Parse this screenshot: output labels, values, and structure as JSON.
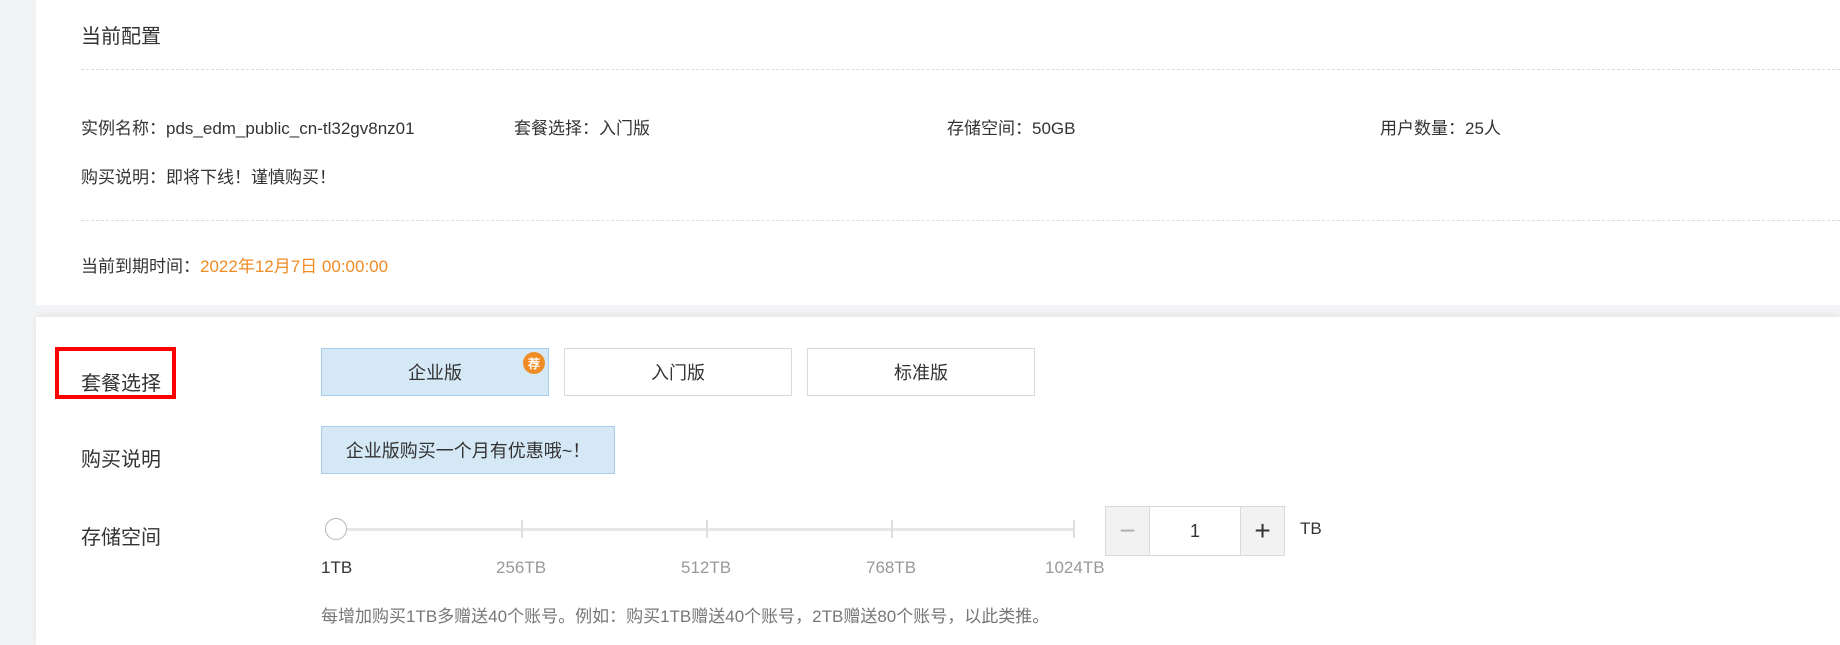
{
  "current_config": {
    "title": "当前配置",
    "instance_name": "实例名称：pds_edm_public_cn-tl32gv8nz01",
    "package": "套餐选择：入门版",
    "storage": "存储空间：50GB",
    "users": "用户数量：25人",
    "purchase_note": "购买说明：即将下线！谨慎购买！",
    "expiry_label": "当前到期时间：",
    "expiry_value": "2022年12月7日 00:00:00"
  },
  "form": {
    "package_label": "套餐选择",
    "packages": [
      {
        "label": "企业版",
        "badge": "荐"
      },
      {
        "label": "入门版"
      },
      {
        "label": "标准版"
      }
    ],
    "purchase_label": "购买说明",
    "purchase_note": "企业版购买一个月有优惠哦~！",
    "storage_label": "存储空间",
    "storage_ticks": [
      "1TB",
      "256TB",
      "512TB",
      "768TB",
      "1024TB"
    ],
    "storage_value": "1",
    "storage_unit": "TB",
    "stepper_minus": "−",
    "stepper_plus": "+",
    "storage_hint": "每增加购买1TB多赠送40个账号。例如：购买1TB赠送40个账号，2TB赠送80个账号，以此类推。"
  },
  "colors": {
    "accent_orange": "#f08c25",
    "selected_bg": "#d5e8f6",
    "highlight_red": "#ff0000"
  }
}
